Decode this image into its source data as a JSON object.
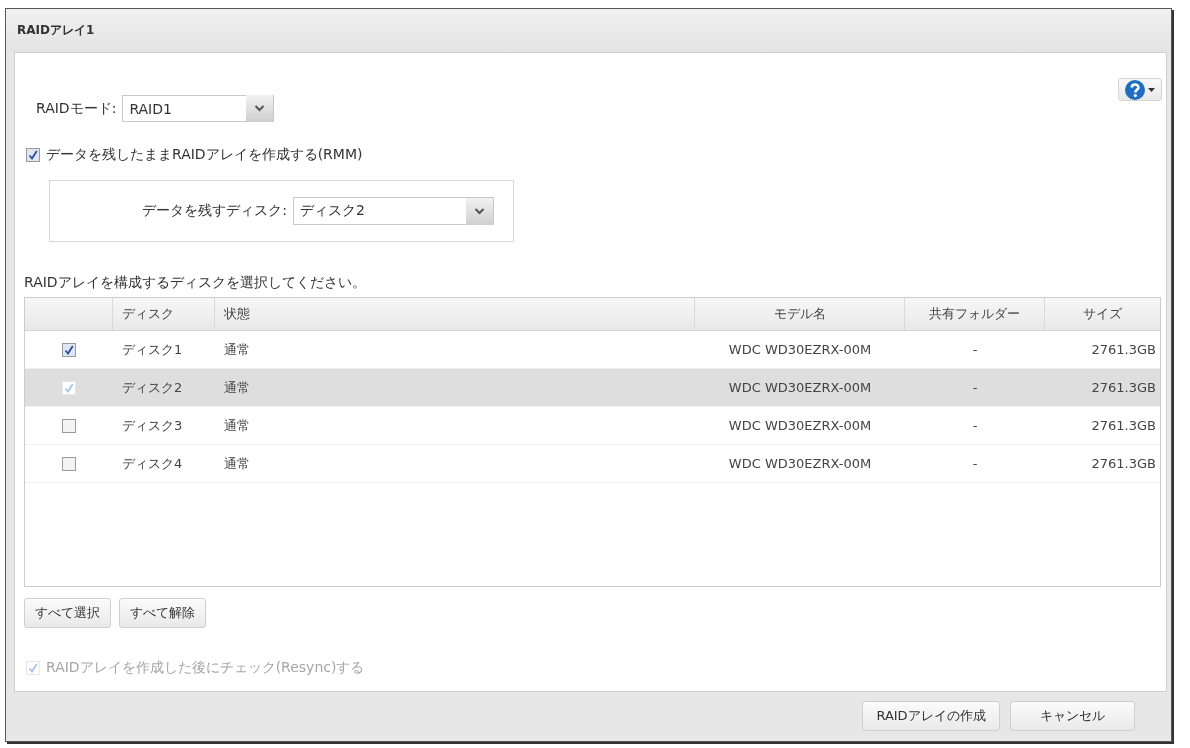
{
  "dialog": {
    "title": "RAIDアレイ1"
  },
  "raid_mode": {
    "label": "RAIDモード:",
    "value": "RAID1"
  },
  "keep_data": {
    "label": "データを残したままRAIDアレイを作成する(RMM)",
    "checked": true
  },
  "keep_disk": {
    "label": "データを残すディスク:",
    "value": "ディスク2"
  },
  "instruction": "RAIDアレイを構成するディスクを選択してください。",
  "table": {
    "columns": [
      "ディスク",
      "状態",
      "モデル名",
      "共有フォルダー",
      "サイズ"
    ],
    "rows": [
      {
        "checked": true,
        "disabled": false,
        "selected": false,
        "cells": [
          "ディスク1",
          "通常",
          "WDC WD30EZRX-00M",
          "-",
          "2761.3GB"
        ]
      },
      {
        "checked": true,
        "disabled": true,
        "selected": true,
        "cells": [
          "ディスク2",
          "通常",
          "WDC WD30EZRX-00M",
          "-",
          "2761.3GB"
        ]
      },
      {
        "checked": false,
        "disabled": false,
        "selected": false,
        "cells": [
          "ディスク3",
          "通常",
          "WDC WD30EZRX-00M",
          "-",
          "2761.3GB"
        ]
      },
      {
        "checked": false,
        "disabled": false,
        "selected": false,
        "cells": [
          "ディスク4",
          "通常",
          "WDC WD30EZRX-00M",
          "-",
          "2761.3GB"
        ]
      }
    ]
  },
  "select_buttons": [
    "すべて選択",
    "すべて解除"
  ],
  "resync": {
    "label": "RAIDアレイを作成した後にチェック(Resync)する",
    "checked": true,
    "disabled": true
  },
  "buttons": [
    "RAIDアレイの作成",
    "キャンセル"
  ]
}
